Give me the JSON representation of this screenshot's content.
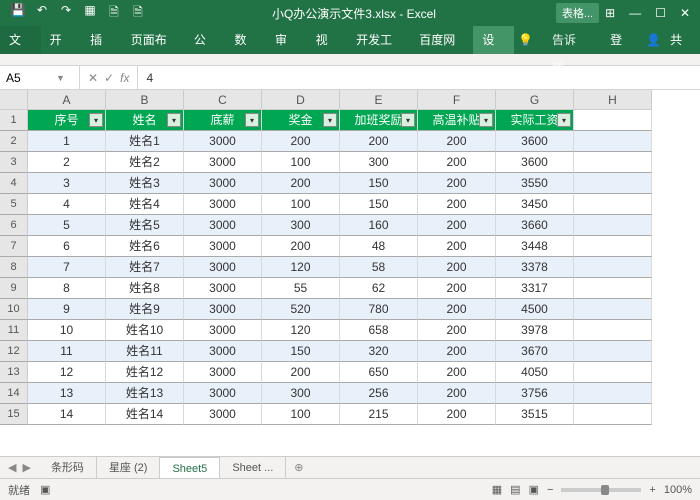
{
  "titlebar": {
    "title": "小Q办公演示文件3.xlsx - Excel",
    "context_tab": "表格..."
  },
  "qat": {
    "save": "💾",
    "undo": "↶",
    "redo": "↷",
    "more1": "▦",
    "more2": "🗎",
    "more3": "🗎"
  },
  "win": {
    "min": "—",
    "max": "☐",
    "close": "✕",
    "opts": "⊞"
  },
  "tabs": {
    "file": "文件",
    "items": [
      "开始",
      "插入",
      "页面布局",
      "公式",
      "数据",
      "审阅",
      "视图",
      "开发工具",
      "百度网盘"
    ],
    "design": "设计",
    "tell": "告诉我...",
    "login": "登录",
    "share": "共享"
  },
  "fx": {
    "name": "A5",
    "label": "fx",
    "value": "4"
  },
  "cols": [
    "A",
    "B",
    "C",
    "D",
    "E",
    "F",
    "G",
    "H"
  ],
  "headers": [
    "序号",
    "姓名",
    "底薪",
    "奖金",
    "加班奖励",
    "高温补贴",
    "实际工资"
  ],
  "rows": [
    {
      "n": 1,
      "d": [
        1,
        "姓名1",
        3000,
        200,
        200,
        200,
        3600
      ]
    },
    {
      "n": 2,
      "d": [
        2,
        "姓名2",
        3000,
        100,
        300,
        200,
        3600
      ]
    },
    {
      "n": 3,
      "d": [
        3,
        "姓名3",
        3000,
        200,
        150,
        200,
        3550
      ]
    },
    {
      "n": 4,
      "d": [
        4,
        "姓名4",
        3000,
        100,
        150,
        200,
        3450
      ]
    },
    {
      "n": 5,
      "d": [
        5,
        "姓名5",
        3000,
        300,
        160,
        200,
        3660
      ]
    },
    {
      "n": 6,
      "d": [
        6,
        "姓名6",
        3000,
        200,
        48,
        200,
        3448
      ]
    },
    {
      "n": 7,
      "d": [
        7,
        "姓名7",
        3000,
        120,
        58,
        200,
        3378
      ]
    },
    {
      "n": 8,
      "d": [
        8,
        "姓名8",
        3000,
        55,
        62,
        200,
        3317
      ]
    },
    {
      "n": 9,
      "d": [
        9,
        "姓名9",
        3000,
        520,
        780,
        200,
        4500
      ]
    },
    {
      "n": 10,
      "d": [
        10,
        "姓名10",
        3000,
        120,
        658,
        200,
        3978
      ]
    },
    {
      "n": 11,
      "d": [
        11,
        "姓名11",
        3000,
        150,
        320,
        200,
        3670
      ]
    },
    {
      "n": 12,
      "d": [
        12,
        "姓名12",
        3000,
        200,
        650,
        200,
        4050
      ]
    },
    {
      "n": 13,
      "d": [
        13,
        "姓名13",
        3000,
        300,
        256,
        200,
        3756
      ]
    },
    {
      "n": 14,
      "d": [
        14,
        "姓名14",
        3000,
        100,
        215,
        200,
        3515
      ]
    }
  ],
  "sheets": {
    "items": [
      "条形码",
      "星座 (2)",
      "Sheet5",
      "Sheet ..."
    ],
    "active": 2,
    "add": "⊕"
  },
  "status": {
    "ready": "就绪",
    "views": [
      "▦",
      "▤",
      "▣"
    ],
    "zoom_out": "−",
    "zoom_in": "+",
    "zoom": "100%"
  }
}
